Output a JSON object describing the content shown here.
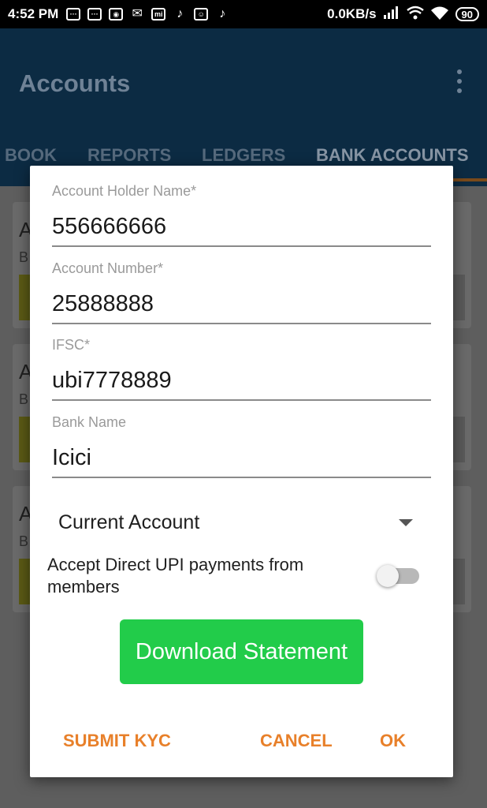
{
  "status_bar": {
    "time": "4:52 PM",
    "notification_icons": [
      "message-icon",
      "message-icon",
      "game-icon",
      "mail-open-icon",
      "mi-icon",
      "tiktok-icon",
      "cat-icon",
      "tiktok-icon"
    ],
    "mi_label": "mi",
    "network_speed": "0.0KB/s",
    "battery": "90"
  },
  "app_bar": {
    "title": "Accounts",
    "tabs": [
      "BOOK",
      "REPORTS",
      "LEDGERS",
      "BANK ACCOUNTS"
    ],
    "active_tab": "BANK ACCOUNTS"
  },
  "dialog": {
    "fields": [
      {
        "label": "Account Holder Name*",
        "value": "556666666"
      },
      {
        "label": "Account Number*",
        "value": "25888888"
      },
      {
        "label": "IFSC*",
        "value": "ubi7778889"
      },
      {
        "label": "Bank Name",
        "value": "Icici"
      }
    ],
    "account_type": "Current Account",
    "upi_label": "Accept Direct UPI payments from members",
    "upi_enabled": false,
    "download_label": "Download Statement",
    "actions": {
      "submit_kyc": "SUBMIT KYC",
      "cancel": "CANCEL",
      "ok": "OK"
    }
  },
  "colors": {
    "accent": "#E8802A",
    "download_button": "#22CC4A",
    "app_bar": "#0C2B43"
  }
}
